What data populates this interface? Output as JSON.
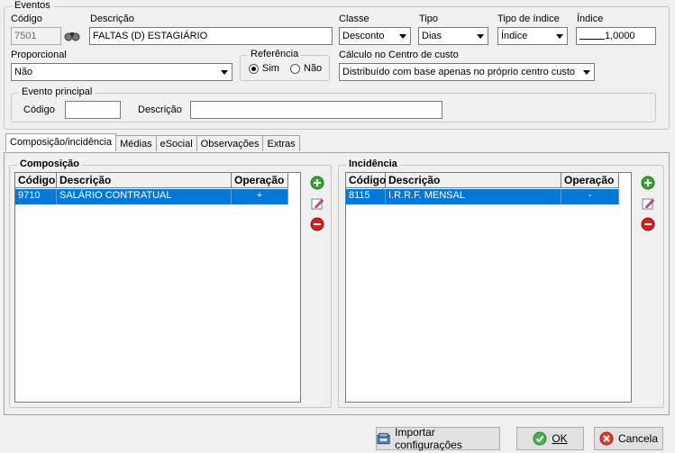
{
  "eventos": {
    "legend": "Eventos",
    "codigo_label": "Código",
    "codigo_value": "7501",
    "descricao_label": "Descrição",
    "descricao_value": "FALTAS (D) ESTAGIÁRIO",
    "classe_label": "Classe",
    "classe_value": "Desconto",
    "tipo_label": "Tipo",
    "tipo_value": "Dias",
    "tipo_indice_label": "Tipo de índice",
    "tipo_indice_value": "Índice",
    "indice_label": "Índice",
    "indice_value": "1,0000",
    "proporcional_label": "Proporcional",
    "proporcional_value": "Não",
    "referencia_legend": "Referência",
    "referencia_sim": "Sim",
    "referencia_nao": "Não",
    "calculo_label": "Cálculo no Centro de custo",
    "calculo_value": "Distribuído com base apenas no próprio centro custo",
    "evento_principal_legend": "Evento principal",
    "ep_codigo_label": "Código",
    "ep_descricao_label": "Descrição"
  },
  "tabs": [
    "Composição/incidência",
    "Médias",
    "eSocial",
    "Observações",
    "Extras"
  ],
  "composicao": {
    "legend": "Composição",
    "columns": [
      "Código",
      "Descrição",
      "Operação"
    ],
    "rows": [
      {
        "codigo": "9710",
        "descricao": "SALÁRIO CONTRATUAL",
        "operacao": "+"
      }
    ]
  },
  "incidencia": {
    "legend": "Incidência",
    "columns": [
      "Código",
      "Descrição",
      "Operação"
    ],
    "rows": [
      {
        "codigo": "8115",
        "descricao": "I.R.R.F. MENSAL",
        "operacao": "-"
      }
    ]
  },
  "buttons": {
    "importar": "Importar configurações",
    "ok": "OK",
    "cancelar": "Cancela"
  }
}
